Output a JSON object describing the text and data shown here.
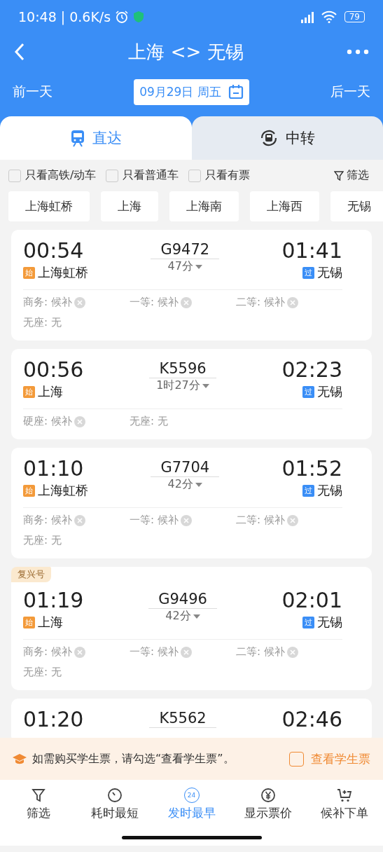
{
  "status_bar": {
    "time": "10:48",
    "separator": "|",
    "speed": "0.6K/s",
    "battery": "79"
  },
  "nav": {
    "title": "上海 <> 无锡"
  },
  "date_bar": {
    "prev": "前一天",
    "date": "09月29日 周五",
    "next": "后一天"
  },
  "tabs": [
    {
      "label": "直达",
      "kind": "direct",
      "selected": true
    },
    {
      "label": "中转",
      "kind": "transfer",
      "selected": false
    }
  ],
  "filters": [
    {
      "label": "只看高铁/动车",
      "checked": false
    },
    {
      "label": "只看普通车",
      "checked": false
    },
    {
      "label": "只看有票",
      "checked": false
    }
  ],
  "filter_button": "筛选",
  "stations": [
    "上海虹桥",
    "上海",
    "上海南",
    "上海西",
    "无锡"
  ],
  "trains": [
    {
      "depart": "00:54",
      "number": "G9472",
      "duration": "47分",
      "arrive": "01:41",
      "from": {
        "badge": "始",
        "kind": "start",
        "name": "上海虹桥"
      },
      "to": {
        "badge": "过",
        "kind": "pass",
        "name": "无锡"
      },
      "seats": [
        {
          "label": "商务: 候补",
          "waitlist": true
        },
        {
          "label": "一等: 候补",
          "waitlist": true
        },
        {
          "label": "二等: 候补",
          "waitlist": true
        },
        {
          "label": "无座: 无",
          "waitlist": false
        }
      ]
    },
    {
      "depart": "00:56",
      "number": "K5596",
      "duration": "1时27分",
      "arrive": "02:23",
      "from": {
        "badge": "始",
        "kind": "start",
        "name": "上海"
      },
      "to": {
        "badge": "过",
        "kind": "pass",
        "name": "无锡"
      },
      "seats": [
        {
          "label": "硬座: 候补",
          "waitlist": true
        },
        {
          "label": "无座: 无",
          "waitlist": false
        }
      ]
    },
    {
      "depart": "01:10",
      "number": "G7704",
      "duration": "42分",
      "arrive": "01:52",
      "from": {
        "badge": "始",
        "kind": "start",
        "name": "上海虹桥"
      },
      "to": {
        "badge": "过",
        "kind": "pass",
        "name": "无锡"
      },
      "seats": [
        {
          "label": "商务: 候补",
          "waitlist": true
        },
        {
          "label": "一等: 候补",
          "waitlist": true
        },
        {
          "label": "二等: 候补",
          "waitlist": true
        },
        {
          "label": "无座: 无",
          "waitlist": false
        }
      ]
    },
    {
      "tag": "复兴号",
      "depart": "01:19",
      "number": "G9496",
      "duration": "42分",
      "arrive": "02:01",
      "from": {
        "badge": "始",
        "kind": "start",
        "name": "上海"
      },
      "to": {
        "badge": "过",
        "kind": "pass",
        "name": "无锡"
      },
      "seats": [
        {
          "label": "商务: 候补",
          "waitlist": true
        },
        {
          "label": "一等: 候补",
          "waitlist": true
        },
        {
          "label": "二等: 候补",
          "waitlist": true
        },
        {
          "label": "无座: 无",
          "waitlist": false
        }
      ]
    },
    {
      "depart": "01:20",
      "number": "K5562",
      "arrive": "02:46"
    }
  ],
  "student_banner": {
    "text": "如需购买学生票，请勾选“查看学生票”。",
    "option": "查看学生票",
    "checked": false
  },
  "bottom_nav": [
    {
      "label": "筛选",
      "kind": "filter",
      "selected": false
    },
    {
      "label": "耗时最短",
      "kind": "clock",
      "selected": false
    },
    {
      "label": "发时最早",
      "kind": "badge",
      "icon_text": "24",
      "selected": true
    },
    {
      "label": "显示票价",
      "kind": "yen",
      "selected": false
    },
    {
      "label": "候补下单",
      "kind": "cart",
      "selected": false
    }
  ]
}
